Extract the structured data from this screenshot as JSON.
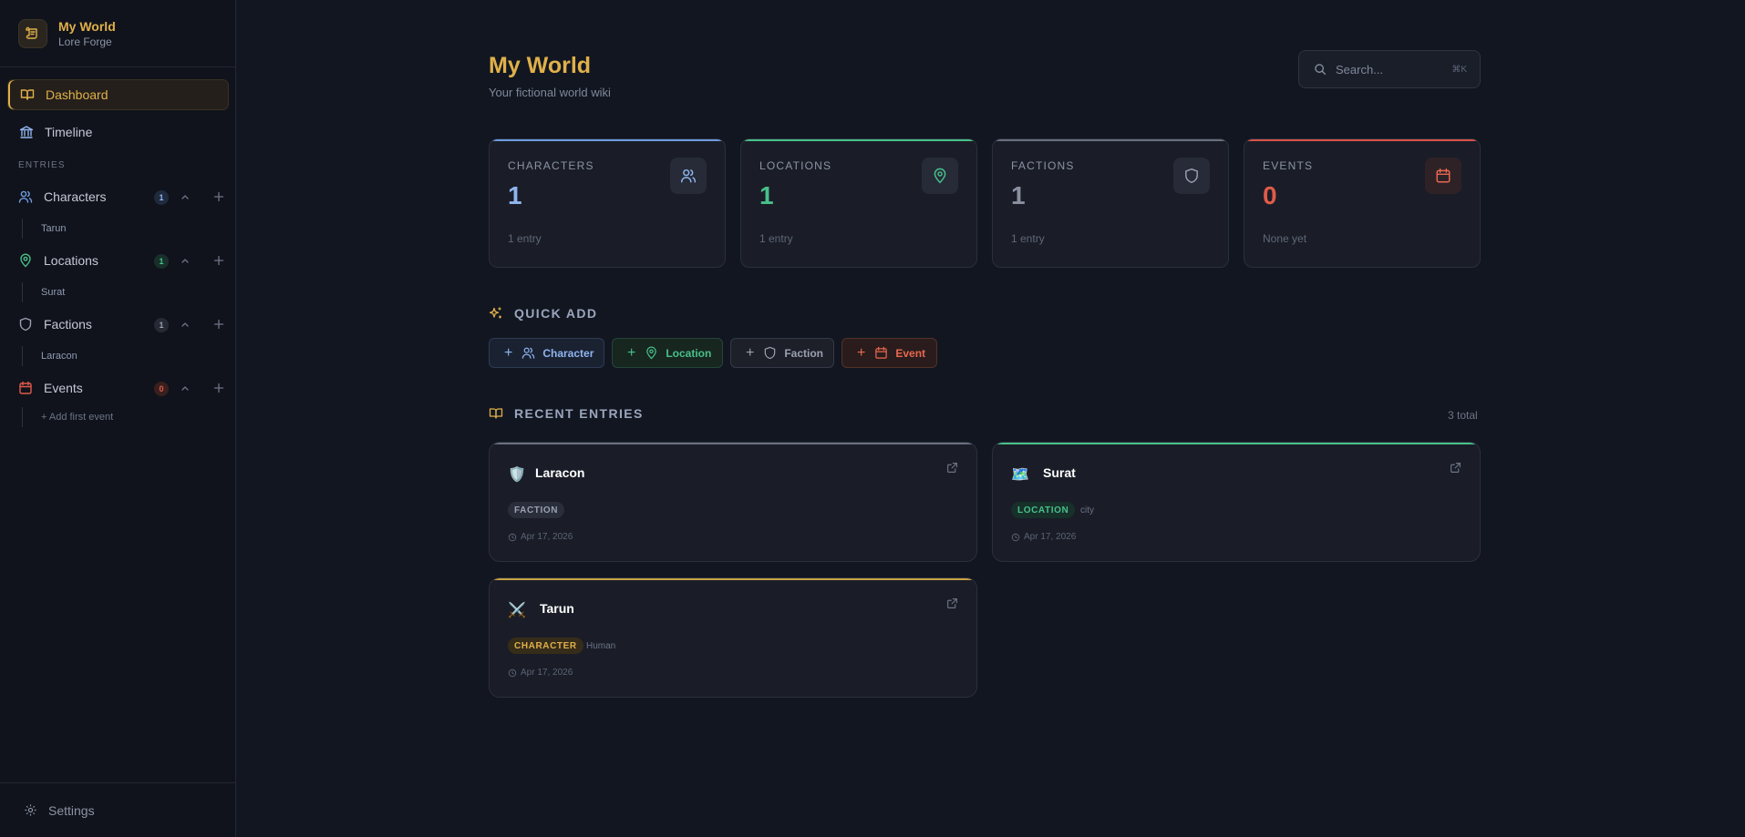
{
  "brand": {
    "title": "My World",
    "subtitle": "Lore Forge"
  },
  "nav": {
    "dashboard": "Dashboard",
    "timeline": "Timeline"
  },
  "sidebar": {
    "section_title": "ENTRIES",
    "categories": [
      {
        "label": "Characters",
        "count": "1",
        "child": "Tarun",
        "color": "#6f9be0"
      },
      {
        "label": "Locations",
        "count": "1",
        "child": "Surat",
        "color": "#48c08a"
      },
      {
        "label": "Factions",
        "count": "1",
        "child": "Laracon",
        "color": "#9aa0b0"
      },
      {
        "label": "Events",
        "count": "0",
        "child": "+ Add first event",
        "color": "#e05a4a"
      }
    ],
    "settings": "Settings"
  },
  "header": {
    "title": "My World",
    "subtitle": "Your fictional world wiki"
  },
  "search": {
    "placeholder": "Search...",
    "shortcut": "⌘K"
  },
  "stats": [
    {
      "label": "CHARACTERS",
      "value": "1",
      "foot": "1 entry",
      "color": "#6f9be0"
    },
    {
      "label": "LOCATIONS",
      "value": "1",
      "foot": "1 entry",
      "color": "#48c08a"
    },
    {
      "label": "FACTIONS",
      "value": "1",
      "foot": "1 entry",
      "color": "#9aa0b0"
    },
    {
      "label": "EVENTS",
      "value": "0",
      "foot": "None yet",
      "color": "#e05a4a"
    }
  ],
  "quick_add": {
    "title": "QUICK ADD",
    "buttons": [
      {
        "label": "Character",
        "color": "#8fb4ee"
      },
      {
        "label": "Location",
        "color": "#48c08a"
      },
      {
        "label": "Faction",
        "color": "#9aa0b0"
      },
      {
        "label": "Event",
        "color": "#e8684f"
      }
    ]
  },
  "recent": {
    "title": "RECENT ENTRIES",
    "total": "3 total",
    "entries": [
      {
        "name": "Laracon",
        "emoji": "🛡️",
        "type": "FACTION",
        "subtype": "",
        "date": "Apr 17, 2026",
        "color": "#9aa0b0"
      },
      {
        "name": "Surat",
        "emoji": "🗺️",
        "type": "LOCATION",
        "subtype": "city",
        "date": "Apr 17, 2026",
        "color": "#48c08a"
      },
      {
        "name": "Tarun",
        "emoji": "⚔️",
        "type": "CHARACTER",
        "subtype": "Human",
        "date": "Apr 17, 2026",
        "color": "#e0b04a"
      }
    ]
  }
}
